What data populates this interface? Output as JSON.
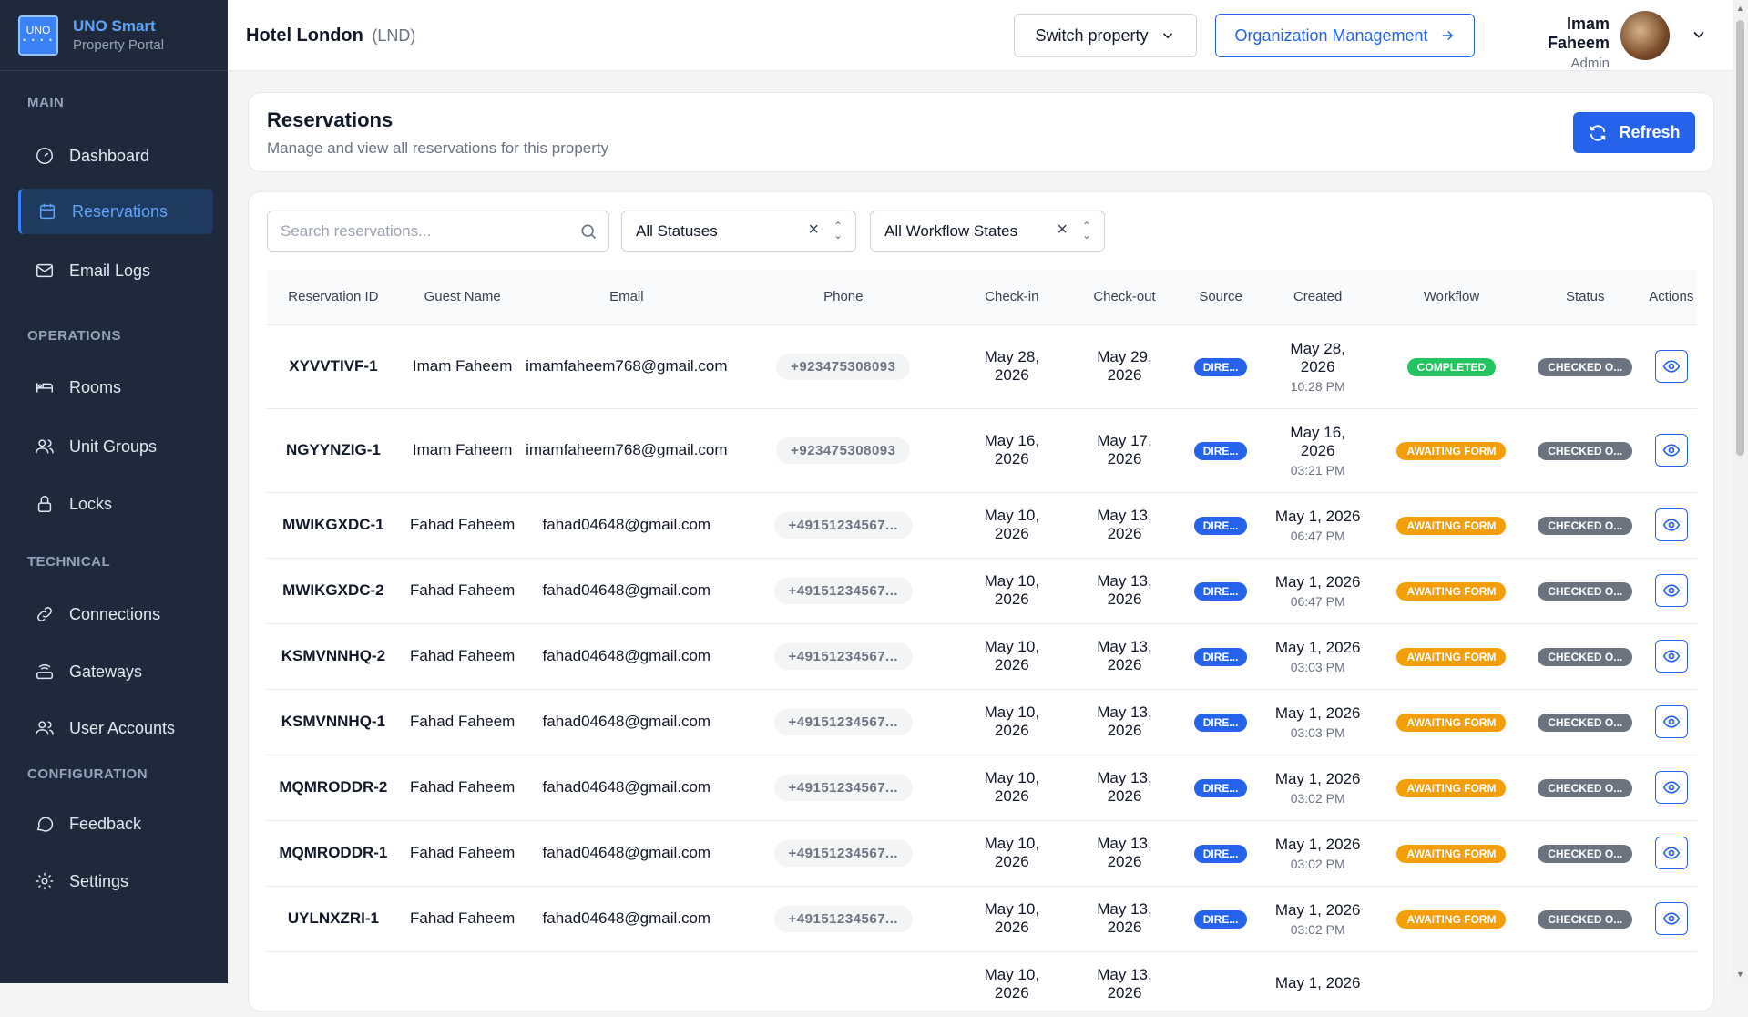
{
  "brand": {
    "logo_text": "UNO",
    "logo_dots": "• • • •",
    "title": "UNO Smart",
    "subtitle": "Property Portal"
  },
  "sidebar": {
    "sections": [
      {
        "label": "MAIN"
      },
      {
        "label": "OPERATIONS"
      },
      {
        "label": "TECHNICAL"
      },
      {
        "label": "CONFIGURATION"
      }
    ],
    "items": [
      {
        "label": "Dashboard",
        "icon": "gauge-icon"
      },
      {
        "label": "Reservations",
        "icon": "calendar-icon",
        "active": true
      },
      {
        "label": "Email Logs",
        "icon": "mail-icon"
      },
      {
        "label": "Rooms",
        "icon": "bed-icon"
      },
      {
        "label": "Unit Groups",
        "icon": "users-icon"
      },
      {
        "label": "Locks",
        "icon": "lock-icon"
      },
      {
        "label": "Connections",
        "icon": "link-icon"
      },
      {
        "label": "Gateways",
        "icon": "router-icon"
      },
      {
        "label": "User Accounts",
        "icon": "user-accounts-icon"
      },
      {
        "label": "Feedback",
        "icon": "message-icon"
      },
      {
        "label": "Settings",
        "icon": "gear-icon"
      }
    ]
  },
  "header": {
    "hotel_name": "Hotel London",
    "hotel_code": "(LND)",
    "switch_label": "Switch property",
    "org_label": "Organization Management",
    "user_name": "Imam Faheem",
    "user_role": "Admin"
  },
  "page": {
    "title": "Reservations",
    "subtitle": "Manage and view all reservations for this property",
    "refresh_label": "Refresh"
  },
  "filters": {
    "search_placeholder": "Search reservations...",
    "status_value": "All Statuses",
    "workflow_value": "All Workflow States"
  },
  "table": {
    "headers": [
      "Reservation ID",
      "Guest Name",
      "Email",
      "Phone",
      "Check-in",
      "Check-out",
      "Source",
      "Created",
      "Workflow",
      "Status",
      "Actions"
    ],
    "rows": [
      {
        "id": "XYVVTIVF-1",
        "guest": "Imam Faheem",
        "email": "imamfaheem768@gmail.com",
        "phone": "+923475308093",
        "checkin": [
          "May 28,",
          "2026"
        ],
        "checkout": [
          "May 29,",
          "2026"
        ],
        "source": "DIRE...",
        "created": [
          "May 28,",
          "2026"
        ],
        "created_time": "10:28 PM",
        "workflow": "COMPLETED",
        "workflow_type": "done",
        "status": "CHECKED O..."
      },
      {
        "id": "NGYYNZIG-1",
        "guest": "Imam Faheem",
        "email": "imamfaheem768@gmail.com",
        "phone": "+923475308093",
        "checkin": [
          "May 16,",
          "2026"
        ],
        "checkout": [
          "May 17,",
          "2026"
        ],
        "source": "DIRE...",
        "created": [
          "May 16,",
          "2026"
        ],
        "created_time": "03:21 PM",
        "workflow": "AWAITING FORM",
        "workflow_type": "await",
        "status": "CHECKED O..."
      },
      {
        "id": "MWIKGXDC-1",
        "guest": "Fahad Faheem",
        "email": "fahad04648@gmail.com",
        "phone": "+49151234567...",
        "checkin": [
          "May 10,",
          "2026"
        ],
        "checkout": [
          "May 13,",
          "2026"
        ],
        "source": "DIRE...",
        "created": [
          "May 1, 2026"
        ],
        "created_time": "06:47 PM",
        "workflow": "AWAITING FORM",
        "workflow_type": "await",
        "status": "CHECKED O..."
      },
      {
        "id": "MWIKGXDC-2",
        "guest": "Fahad Faheem",
        "email": "fahad04648@gmail.com",
        "phone": "+49151234567...",
        "checkin": [
          "May 10,",
          "2026"
        ],
        "checkout": [
          "May 13,",
          "2026"
        ],
        "source": "DIRE...",
        "created": [
          "May 1, 2026"
        ],
        "created_time": "06:47 PM",
        "workflow": "AWAITING FORM",
        "workflow_type": "await",
        "status": "CHECKED O..."
      },
      {
        "id": "KSMVNNHQ-2",
        "guest": "Fahad Faheem",
        "email": "fahad04648@gmail.com",
        "phone": "+49151234567...",
        "checkin": [
          "May 10,",
          "2026"
        ],
        "checkout": [
          "May 13,",
          "2026"
        ],
        "source": "DIRE...",
        "created": [
          "May 1, 2026"
        ],
        "created_time": "03:03 PM",
        "workflow": "AWAITING FORM",
        "workflow_type": "await",
        "status": "CHECKED O..."
      },
      {
        "id": "KSMVNNHQ-1",
        "guest": "Fahad Faheem",
        "email": "fahad04648@gmail.com",
        "phone": "+49151234567...",
        "checkin": [
          "May 10,",
          "2026"
        ],
        "checkout": [
          "May 13,",
          "2026"
        ],
        "source": "DIRE...",
        "created": [
          "May 1, 2026"
        ],
        "created_time": "03:03 PM",
        "workflow": "AWAITING FORM",
        "workflow_type": "await",
        "status": "CHECKED O..."
      },
      {
        "id": "MQMRODDR-2",
        "guest": "Fahad Faheem",
        "email": "fahad04648@gmail.com",
        "phone": "+49151234567...",
        "checkin": [
          "May 10,",
          "2026"
        ],
        "checkout": [
          "May 13,",
          "2026"
        ],
        "source": "DIRE...",
        "created": [
          "May 1, 2026"
        ],
        "created_time": "03:02 PM",
        "workflow": "AWAITING FORM",
        "workflow_type": "await",
        "status": "CHECKED O..."
      },
      {
        "id": "MQMRODDR-1",
        "guest": "Fahad Faheem",
        "email": "fahad04648@gmail.com",
        "phone": "+49151234567...",
        "checkin": [
          "May 10,",
          "2026"
        ],
        "checkout": [
          "May 13,",
          "2026"
        ],
        "source": "DIRE...",
        "created": [
          "May 1, 2026"
        ],
        "created_time": "03:02 PM",
        "workflow": "AWAITING FORM",
        "workflow_type": "await",
        "status": "CHECKED O..."
      },
      {
        "id": "UYLNXZRI-1",
        "guest": "Fahad Faheem",
        "email": "fahad04648@gmail.com",
        "phone": "+49151234567...",
        "checkin": [
          "May 10,",
          "2026"
        ],
        "checkout": [
          "May 13,",
          "2026"
        ],
        "source": "DIRE...",
        "created": [
          "May 1, 2026"
        ],
        "created_time": "03:02 PM",
        "workflow": "AWAITING FORM",
        "workflow_type": "await",
        "status": "CHECKED O..."
      },
      {
        "id": "",
        "guest": "",
        "email": "",
        "phone": "",
        "checkin": [
          "May 10,",
          "2026"
        ],
        "checkout": [
          "May 13,",
          "2026"
        ],
        "source": "",
        "created": [
          "May 1, 2026"
        ],
        "created_time": "",
        "workflow": "",
        "workflow_type": "await",
        "status": ""
      }
    ]
  },
  "colors": {
    "sidebar_bg": "#1e293b",
    "accent": "#2563eb",
    "completed": "#22c55e",
    "awaiting": "#f59e0b",
    "status": "#6b7280"
  }
}
